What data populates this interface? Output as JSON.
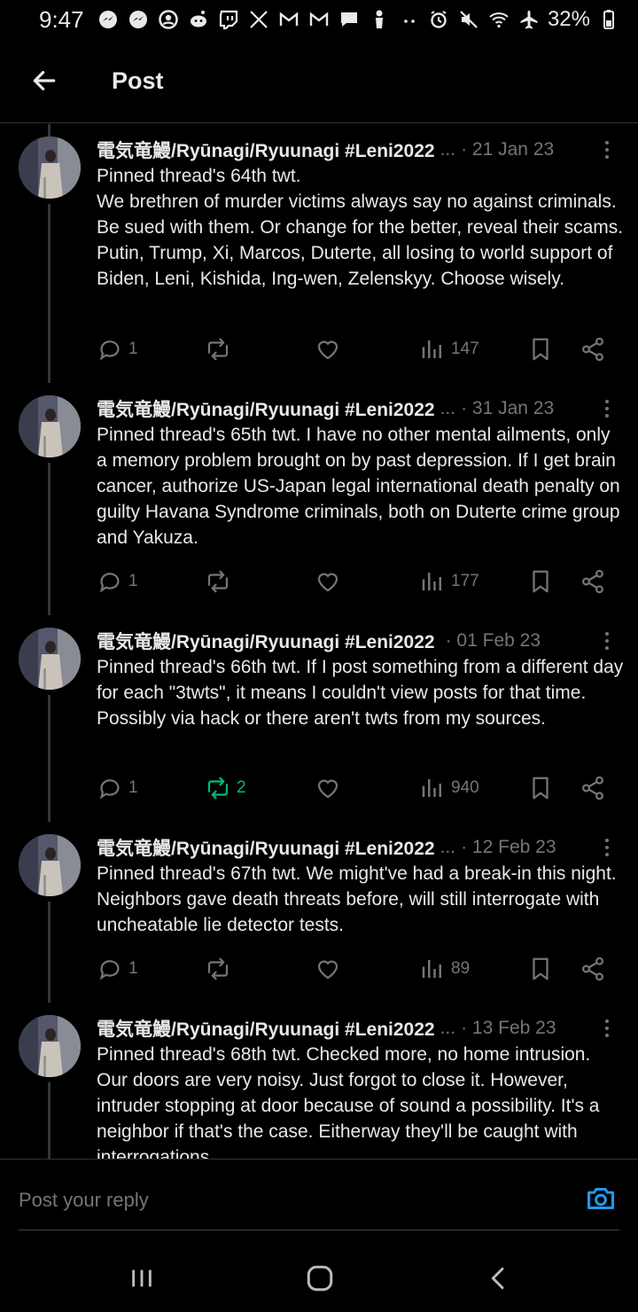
{
  "status_bar": {
    "time": "9:47",
    "left_icons": [
      "messenger-icon",
      "messenger-icon",
      "user-circle-icon",
      "reddit-icon",
      "twitch-icon",
      "x-icon",
      "gmail-icon",
      "gmail-icon",
      "chat-icon",
      "person-icon",
      "more-dots-icon"
    ],
    "right_icons": [
      "alarm-icon",
      "mute-icon",
      "wifi-icon",
      "airplane-icon"
    ],
    "battery": "32%"
  },
  "header": {
    "title": "Post"
  },
  "tweets": [
    {
      "name": "電気竜鰻/Ryūnagi/Ryuunagi #Leni2022",
      "truncated": "...",
      "date": "· 21 Jan 23",
      "text": "Pinned thread's 64th twt.\nWe brethren of murder victims always say no against criminals. Be sued with them. Or change for the better, reveal their scams. Putin, Trump, Xi, Marcos, Duterte, all losing to world support of Biden, Leni, Kishida, Ing-wen, Zelenskyy. Choose wisely.",
      "replies": "1",
      "reposts": "",
      "likes": "",
      "views": "147"
    },
    {
      "name": "電気竜鰻/Ryūnagi/Ryuunagi #Leni2022",
      "truncated": "...",
      "date": "· 31 Jan 23",
      "text": "Pinned thread's 65th twt. I have no other mental ailments, only a memory problem brought on by past depression. If I get brain cancer, authorize US-Japan legal international death penalty on guilty Havana Syndrome criminals, both on Duterte crime group and Yakuza.",
      "replies": "1",
      "reposts": "",
      "likes": "",
      "views": "177"
    },
    {
      "name": "電気竜鰻/Ryūnagi/Ryuunagi #Leni2022",
      "truncated": "",
      "date": "· 01 Feb 23",
      "text": "Pinned thread's 66th twt. If I post something from a different day for each \"3twts\", it means I couldn't view posts for that time. Possibly via hack or there aren't twts from my sources.",
      "replies": "1",
      "reposts": "2",
      "likes": "",
      "views": "940"
    },
    {
      "name": "電気竜鰻/Ryūnagi/Ryuunagi #Leni2022",
      "truncated": "...",
      "date": "· 12 Feb 23",
      "text": "Pinned thread's 67th twt. We might've had a break-in this night. Neighbors gave death threats before, will still interrogate with uncheatable lie detector tests.",
      "replies": "1",
      "reposts": "",
      "likes": "",
      "views": "89"
    },
    {
      "name": "電気竜鰻/Ryūnagi/Ryuunagi #Leni2022",
      "truncated": "...",
      "date": "· 13 Feb 23",
      "text": "Pinned thread's 68th twt. Checked more, no home intrusion. Our doors are very noisy. Just forgot to close it. However, intruder stopping at door because of sound a possibility. It's a neighbor if that's the case. Eitherway they'll be caught with interrogations.",
      "replies": "",
      "reposts": "",
      "likes": "",
      "views": ""
    }
  ],
  "reply_bar": {
    "placeholder": "Post your reply"
  },
  "colors": {
    "background": "#000000",
    "text": "#e7e9ea",
    "muted": "#71767b",
    "repost_active": "#00ba7c",
    "accent": "#1d9bf0",
    "divider": "#2f3336"
  }
}
